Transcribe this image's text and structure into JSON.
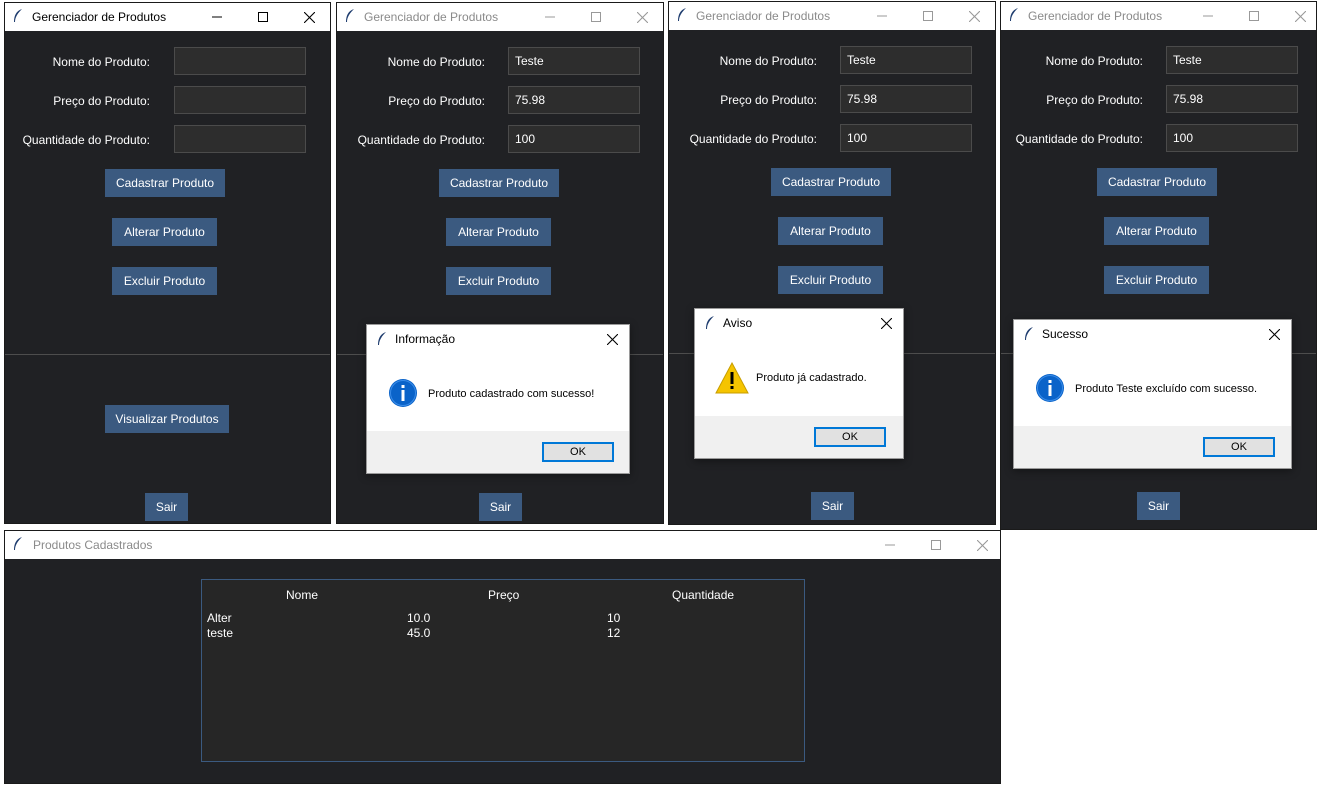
{
  "app_title": "Gerenciador de Produtos",
  "form": {
    "name_label": "Nome do Produto:",
    "price_label": "Preço do Produto:",
    "qty_label": "Quantidade do Produto:",
    "register_button": "Cadastrar Produto",
    "edit_button": "Alterar Produto",
    "delete_button": "Excluir Produto",
    "view_button": "Visualizar Produtos",
    "exit_button": "Sair"
  },
  "values": {
    "name": "Teste",
    "price": "75.98",
    "qty": "100"
  },
  "dialogs": {
    "info": {
      "title": "Informação",
      "message": "Produto cadastrado com sucesso!",
      "ok": "OK"
    },
    "warning": {
      "title": "Aviso",
      "message": "Produto já cadastrado.",
      "ok": "OK"
    },
    "success": {
      "title": "Sucesso",
      "message": "Produto Teste excluído com sucesso.",
      "ok": "OK"
    }
  },
  "list_window": {
    "title": "Produtos Cadastrados",
    "columns": [
      "Nome",
      "Preço",
      "Quantidade"
    ],
    "rows": [
      {
        "name": "Alter",
        "price": "10.0",
        "qty": "10"
      },
      {
        "name": "teste",
        "price": "45.0",
        "qty": "12"
      }
    ]
  },
  "colors": {
    "window_bg": "#202124",
    "button_bg": "#3b5a80",
    "entry_bg": "#2d2d2d",
    "info_icon": "#0a63c9",
    "warning_icon": "#f5c400"
  },
  "icons": {
    "app": "feather-icon",
    "minimize": "minimize-icon",
    "maximize": "maximize-icon",
    "close": "close-icon",
    "info": "info-icon",
    "warning": "warning-icon"
  }
}
